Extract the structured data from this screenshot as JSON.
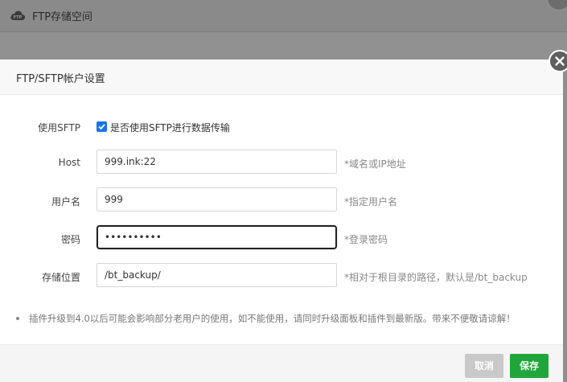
{
  "background": {
    "window_title": "FTP存储空间"
  },
  "dialog": {
    "title": "FTP/SFTP帐户设置",
    "sftp": {
      "label": "使用SFTP",
      "checked": true,
      "checkbox_text": "是否使用SFTP进行数据传输"
    },
    "host": {
      "label": "Host",
      "value": "999.ink:22",
      "hint": "*域名或IP地址"
    },
    "username": {
      "label": "用户名",
      "value": "999",
      "hint": "*指定用户名"
    },
    "password": {
      "label": "密码",
      "value": "••••••••••",
      "hint": "*登录密码"
    },
    "storage_path": {
      "label": "存储位置",
      "value": "/bt_backup/",
      "hint": "*相对于根目录的路径，默认是/bt_backup"
    },
    "notice": "插件升级到4.0以后可能会影响部分老用户的使用，如不能使用，请同时升级面板和插件到最新版。带来不便敬请谅解！",
    "buttons": {
      "cancel": "取消",
      "save": "保存"
    }
  },
  "colors": {
    "accent_green": "#20a53a",
    "checkbox_blue": "#1a73e8",
    "cancel_gray": "#c9c9c9",
    "overlay_gray": "#8f8f8f"
  },
  "icons": {
    "window_logo": "ftp-cloud-icon",
    "close": "close-icon",
    "check": "check-icon"
  }
}
